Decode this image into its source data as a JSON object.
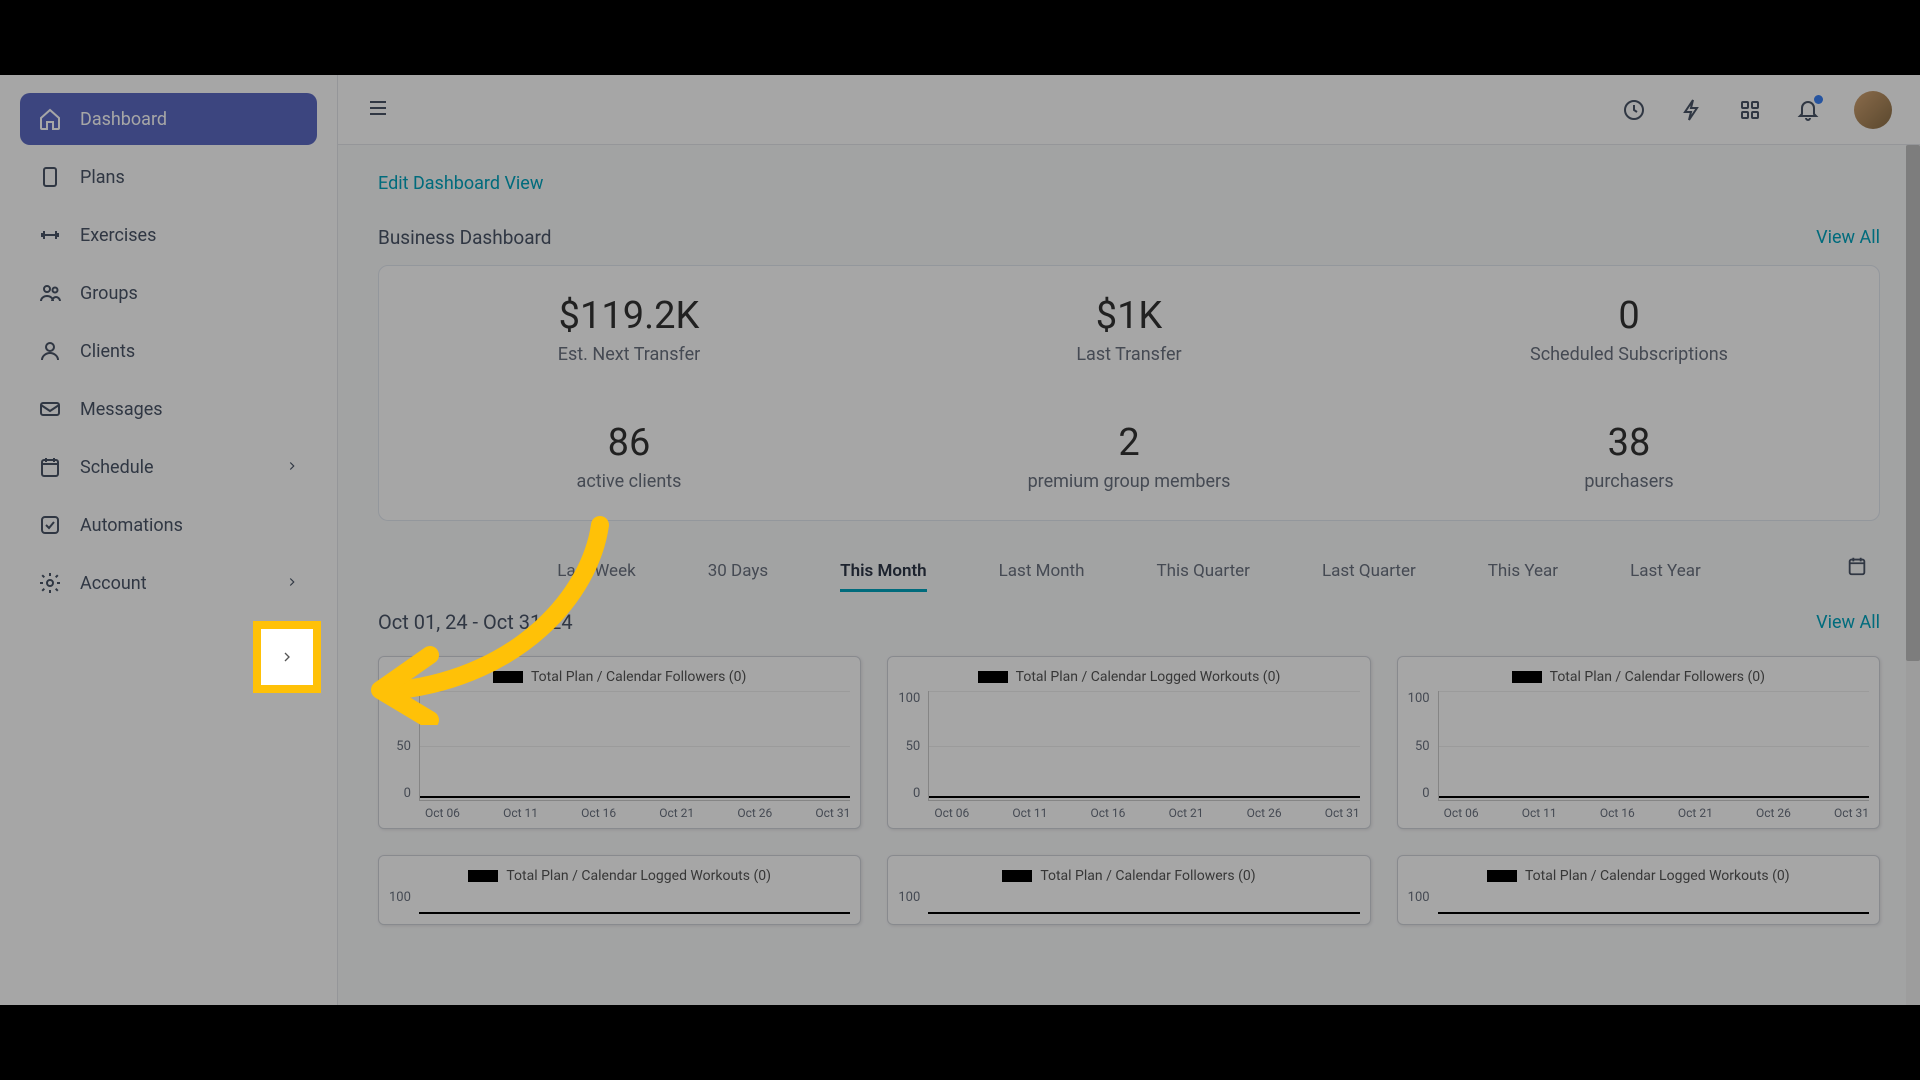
{
  "sidebar": {
    "items": [
      {
        "label": "Dashboard",
        "icon": "home"
      },
      {
        "label": "Plans",
        "icon": "clipboard"
      },
      {
        "label": "Exercises",
        "icon": "dumbbell"
      },
      {
        "label": "Groups",
        "icon": "people"
      },
      {
        "label": "Clients",
        "icon": "person"
      },
      {
        "label": "Messages",
        "icon": "mail"
      },
      {
        "label": "Schedule",
        "icon": "calendar",
        "chevron": true
      },
      {
        "label": "Automations",
        "icon": "check"
      },
      {
        "label": "Account",
        "icon": "gear",
        "chevron": true
      }
    ]
  },
  "topbar": {
    "clock_icon": "clock",
    "bolt_icon": "bolt",
    "apps_icon": "apps",
    "bell_icon": "bell"
  },
  "content": {
    "edit_link": "Edit Dashboard View",
    "business_title": "Business Dashboard",
    "view_all": "View All",
    "stats_top": [
      {
        "value": "$119.2K",
        "label": "Est. Next Transfer"
      },
      {
        "value": "$1K",
        "label": "Last Transfer"
      },
      {
        "value": "0",
        "label": "Scheduled Subscriptions"
      }
    ],
    "stats_bottom": [
      {
        "value": "86",
        "label": "active clients"
      },
      {
        "value": "2",
        "label": "premium group members"
      },
      {
        "value": "38",
        "label": "purchasers"
      }
    ],
    "tabs": [
      "Last Week",
      "30 Days",
      "This Month",
      "Last Month",
      "This Quarter",
      "Last Quarter",
      "This Year",
      "Last Year"
    ],
    "active_tab": "This Month",
    "date_range": "Oct 01, 24 - Oct 31, 24",
    "view_all_2": "View All",
    "charts_row1": [
      {
        "title": "Total Plan / Calendar Followers (0)"
      },
      {
        "title": "Total Plan / Calendar Logged Workouts (0)"
      },
      {
        "title": "Total Plan / Calendar Followers (0)"
      }
    ],
    "charts_row2": [
      {
        "title": "Total Plan / Calendar Logged Workouts (0)"
      },
      {
        "title": "Total Plan / Calendar Followers (0)"
      },
      {
        "title": "Total Plan / Calendar Logged Workouts (0)"
      }
    ]
  },
  "chart_data": {
    "type": "line",
    "categories": [
      "Oct 06",
      "Oct 11",
      "Oct 16",
      "Oct 21",
      "Oct 26",
      "Oct 31"
    ],
    "y_ticks": [
      "100",
      "50",
      "0"
    ],
    "ylim": [
      0,
      100
    ],
    "series": [
      {
        "name": "Total Plan / Calendar Followers (0)",
        "values": [
          0,
          0,
          0,
          0,
          0,
          0
        ]
      },
      {
        "name": "Total Plan / Calendar Logged Workouts (0)",
        "values": [
          0,
          0,
          0,
          0,
          0,
          0
        ]
      },
      {
        "name": "Total Plan / Calendar Followers (0)",
        "values": [
          0,
          0,
          0,
          0,
          0,
          0
        ]
      },
      {
        "name": "Total Plan / Calendar Logged Workouts (0)",
        "values": [
          0,
          0,
          0,
          0,
          0,
          0
        ]
      },
      {
        "name": "Total Plan / Calendar Followers (0)",
        "values": [
          0,
          0,
          0,
          0,
          0,
          0
        ]
      },
      {
        "name": "Total Plan / Calendar Logged Workouts (0)",
        "values": [
          0,
          0,
          0,
          0,
          0,
          0
        ]
      }
    ]
  }
}
